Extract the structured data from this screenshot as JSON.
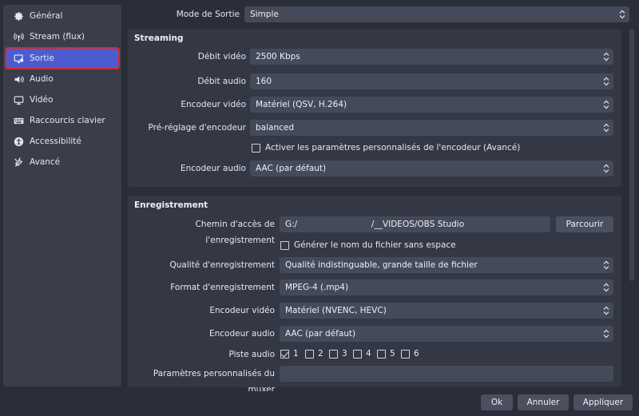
{
  "sidebar": {
    "items": [
      {
        "label": "Général",
        "icon": "gear-icon"
      },
      {
        "label": "Stream (flux)",
        "icon": "broadcast-icon"
      },
      {
        "label": "Sortie",
        "icon": "output-icon",
        "active": true
      },
      {
        "label": "Audio",
        "icon": "speaker-icon"
      },
      {
        "label": "Vidéo",
        "icon": "monitor-icon"
      },
      {
        "label": "Raccourcis clavier",
        "icon": "keyboard-icon"
      },
      {
        "label": "Accessibilité",
        "icon": "accessibility-icon"
      },
      {
        "label": "Avancé",
        "icon": "tools-icon"
      }
    ]
  },
  "output_mode": {
    "label": "Mode de Sortie",
    "value": "Simple"
  },
  "streaming": {
    "title": "Streaming",
    "video_bitrate": {
      "label": "Débit vidéo",
      "value": "2500 Kbps"
    },
    "audio_bitrate": {
      "label": "Débit audio",
      "value": "160"
    },
    "video_encoder": {
      "label": "Encodeur vidéo",
      "value": "Matériel (QSV, H.264)"
    },
    "encoder_preset": {
      "label": "Pré-réglage d'encodeur",
      "value": "balanced"
    },
    "custom_settings": {
      "label": "Activer les paramètres personnalisés de l'encodeur (Avancé)",
      "checked": false
    },
    "audio_encoder": {
      "label": "Encodeur audio",
      "value": "AAC (par défaut)"
    }
  },
  "recording": {
    "title": "Enregistrement",
    "path": {
      "label": "Chemin d'accès de l'enregistrement",
      "value_prefix": "G:/",
      "value_suffix": "/__VIDEOS/OBS Studio"
    },
    "browse_label": "Parcourir",
    "no_space": {
      "label": "Générer le nom du fichier sans espace",
      "checked": false
    },
    "quality": {
      "label": "Qualité d'enregistrement",
      "value": "Qualité indistinguable, grande taille de fichier"
    },
    "format": {
      "label": "Format d'enregistrement",
      "value": "MPEG-4 (.mp4)"
    },
    "video_encoder": {
      "label": "Encodeur vidéo",
      "value": "Matériel (NVENC, HEVC)"
    },
    "audio_encoder": {
      "label": "Encodeur audio",
      "value": "AAC (par défaut)"
    },
    "audio_track": {
      "label": "Piste audio",
      "tracks": [
        {
          "num": "1",
          "checked": true
        },
        {
          "num": "2",
          "checked": false
        },
        {
          "num": "3",
          "checked": false
        },
        {
          "num": "4",
          "checked": false
        },
        {
          "num": "5",
          "checked": false
        },
        {
          "num": "6",
          "checked": false
        }
      ]
    },
    "muxer": {
      "label": "Paramètres personnalisés du muxer",
      "value": ""
    }
  },
  "footer": {
    "ok": "Ok",
    "cancel": "Annuler",
    "apply": "Appliquer"
  },
  "colors": {
    "accent": "#4c5cd0",
    "highlight": "#d12a33",
    "background": "#2b2e38",
    "panel": "#343845",
    "field": "#454a5a"
  }
}
